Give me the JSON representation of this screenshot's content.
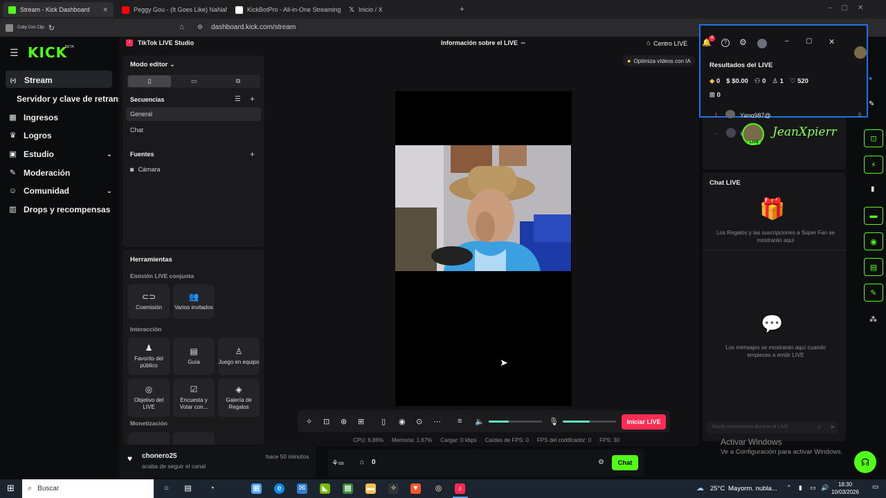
{
  "browser": {
    "tabs": [
      {
        "label": "Stream - Kick Dashboard",
        "active": true,
        "color": "#53fc18"
      },
      {
        "label": "Peggy Gou - (It Goes Like) NaNaNa (",
        "color": "#ff0000"
      },
      {
        "label": "KickBotPro - All-in-One Streaming To",
        "color": "#ffffff"
      },
      {
        "label": "Inicio / X",
        "color": "#ffffff"
      }
    ],
    "url": "dashboard.kick.com/stream",
    "bookmark": "Coby Con Clip"
  },
  "kick": {
    "logo": "KICK",
    "beta": "BETA",
    "nav": [
      {
        "label": "Stream",
        "icon": "broadcast-icon",
        "glyph": "((•))"
      },
      {
        "label": "Servidor y clave de retransm",
        "icon": "",
        "glyph": ""
      },
      {
        "label": "Ingresos",
        "icon": "chart-icon",
        "glyph": "▦"
      },
      {
        "label": "Logros",
        "icon": "trophy-icon",
        "glyph": "♛"
      },
      {
        "label": "Estudio",
        "icon": "camera-icon",
        "glyph": "▣"
      },
      {
        "label": "Moderación",
        "icon": "wrench-icon",
        "glyph": "✎"
      },
      {
        "label": "Comunidad",
        "icon": "people-icon",
        "glyph": "👥"
      },
      {
        "label": "Drops y recompensas",
        "icon": "chart-bars-icon",
        "glyph": "▥"
      }
    ],
    "follower": {
      "name": "chonero25",
      "action": "acaba de seguir el canal",
      "time": "hace 50 minutos"
    },
    "chat_button": "Chat",
    "counter": "0"
  },
  "studio": {
    "app_title": "TikTok LIVE Studio",
    "header_center": "Información sobre el LIVE",
    "centro": "Centro LIVE",
    "optimize": "Optimiza vídeos con IA",
    "mode": "Modo editor",
    "sequences_title": "Secuencias",
    "sequences": [
      "General",
      "Chat"
    ],
    "sources_title": "Fuentes",
    "sources": [
      "Cámara"
    ],
    "tools_title": "Herramientas",
    "sections": {
      "joint": "Emisión LIVE conjunta",
      "interaction": "Interacción",
      "monetization": "Monetización"
    },
    "joint_tools": [
      "Coemisión",
      "Varios invitados"
    ],
    "interaction_tools": [
      "Favorito del público",
      "Guía",
      "Juego en equipo",
      "Objetivo del LIVE",
      "Encuesta y Votar con...",
      "Galería de Regalos"
    ],
    "go_live": "Iniciar LIVE",
    "stats": {
      "cpu": "CPU: 6.86%",
      "mem": "Memoria: 1.67%",
      "upload": "Cargar: 0 kbps",
      "drops": "Caídas de FPS: 0",
      "enc": "FPS del codificador: 0",
      "fps": "FPS: 30"
    },
    "volume_level": 0.38,
    "mic_level": 0.5
  },
  "results": {
    "title": "Resultados del LIVE",
    "diamonds": "0",
    "money": "$0.00",
    "viewers": "0",
    "followers": "1",
    "likes": "520",
    "gifts": "0",
    "ranking": [
      {
        "rank": "1",
        "name": "Yano987@",
        "score": "5"
      },
      {
        "rank": "2",
        "name": "i",
        "score": ""
      }
    ],
    "overlay_name": "JeanXpierr",
    "live_badge": "LIVE"
  },
  "chat": {
    "title": "Chat LIVE",
    "gifts_empty": "Los Regalos y las suscripciones a Super Fan se mostrarán aquí",
    "messages_empty": "Los mensajes se mostrarán aquí cuando empieces a emitir LIVE",
    "input_placeholder": "Añadir comentarios durante el LIVE"
  },
  "windows": {
    "activate_title": "Activar Windows",
    "activate_sub": "Ve a Configuración para activar Windows.",
    "search": "Buscar",
    "weather": "25°C",
    "weather_desc": "Mayorm. nubla...",
    "time": "18:30",
    "date": "10/03/2026"
  }
}
